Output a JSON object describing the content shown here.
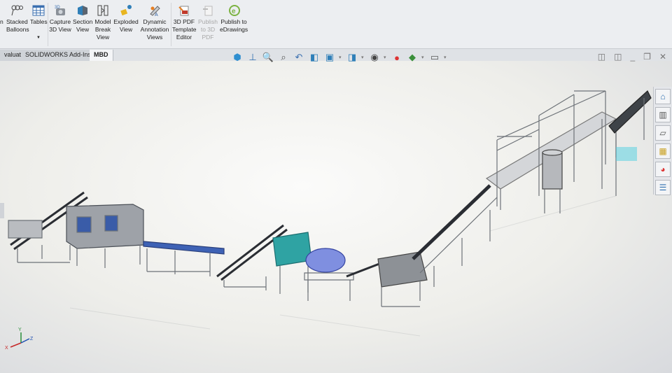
{
  "ribbon": {
    "buttons": [
      {
        "label": "n",
        "icon": "partial-icon",
        "enabled": true
      },
      {
        "label": "Stacked Balloons",
        "icon": "stacked-balloons-icon",
        "enabled": true
      },
      {
        "label": "Tables",
        "icon": "tables-icon",
        "enabled": true
      },
      {
        "label": "Capture 3D View",
        "icon": "capture-3d-view-icon",
        "enabled": true
      },
      {
        "label": "Section View",
        "icon": "section-view-icon",
        "enabled": true
      },
      {
        "label": "Model Break View",
        "icon": "model-break-view-icon",
        "enabled": true
      },
      {
        "label": "Exploded View",
        "icon": "exploded-view-icon",
        "enabled": true
      },
      {
        "label": "Dynamic Annotation Views",
        "icon": "dynamic-annotation-views-icon",
        "enabled": true
      },
      {
        "label": "3D PDF Template Editor",
        "icon": "3d-pdf-template-editor-icon",
        "enabled": true
      },
      {
        "label": "Publish to 3D PDF",
        "icon": "publish-3d-pdf-icon",
        "enabled": false
      },
      {
        "label": "Publish to eDrawings",
        "icon": "edrawings-icon",
        "enabled": true
      }
    ]
  },
  "tabs": [
    {
      "label": "valuate",
      "active": false
    },
    {
      "label": "SOLIDWORKS Add-Ins",
      "active": false
    },
    {
      "label": "MBD",
      "active": true
    }
  ],
  "axis_labels": {
    "x": "X",
    "y": "Y",
    "z": "Z"
  }
}
